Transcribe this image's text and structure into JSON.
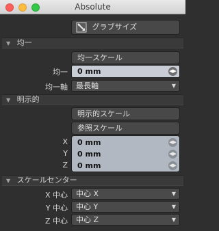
{
  "window": {
    "title": "Absolute"
  },
  "grab_size": {
    "label": "グラブサイズ"
  },
  "uniform": {
    "section_label": "均一",
    "scale_button": "均一スケール",
    "value_label": "均一",
    "value": "0 mm",
    "axis_label": "均一軸",
    "axis_value": "最長軸"
  },
  "explicit": {
    "section_label": "明示的",
    "scale_button": "明示的スケール",
    "reference_button": "参照スケール",
    "x_label": "X",
    "x_value": "0 mm",
    "y_label": "Y",
    "y_value": "0 mm",
    "z_label": "Z",
    "z_value": "0 mm"
  },
  "scale_center": {
    "section_label": "スケールセンター",
    "x_label": "X 中心",
    "x_value": "中心 X",
    "y_label": "Y 中心",
    "y_value": "中心 Y",
    "z_label": "Z 中心",
    "z_value": "中心 Z"
  },
  "colors": {
    "field_active": "#c9ced6",
    "field_inactive": "#b2b8c1",
    "panel_bg": "#2f2f2f"
  }
}
